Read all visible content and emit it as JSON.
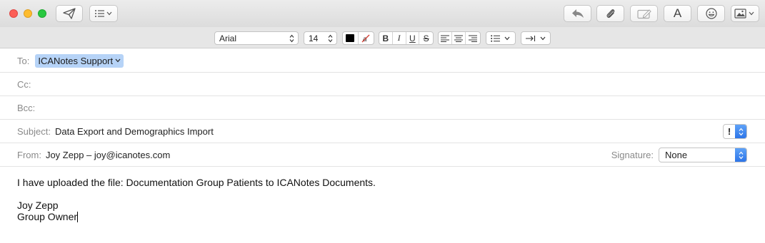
{
  "window": {
    "traffic_lights": [
      "close",
      "minimize",
      "zoom"
    ]
  },
  "toolbar": {
    "left_icons": [
      "send-icon",
      "header-fields-icon"
    ],
    "right_icons": [
      "reply-icon",
      "attachment-icon",
      "markup-icon",
      "fonts-icon",
      "emoji-icon",
      "photo-browser-icon"
    ],
    "fonts_glyph": "A"
  },
  "format_bar": {
    "font_family": "Arial",
    "font_size": "14",
    "text_color": "#000000",
    "style_buttons": [
      "B",
      "I",
      "U",
      "S"
    ],
    "alignment": [
      "align-left",
      "align-center",
      "align-right"
    ],
    "list_icon": "bulleted-list-icon",
    "indent_icon": "indent-icon"
  },
  "header": {
    "to_label": "To:",
    "to_recipient": "ICANotes Support",
    "cc_label": "Cc:",
    "bcc_label": "Bcc:",
    "subject_label": "Subject:",
    "subject_value": "Data Export and Demographics Import",
    "priority_glyph": "!",
    "from_label": "From:",
    "from_value": "Joy Zepp – joy@icanotes.com",
    "signature_label": "Signature:",
    "signature_value": "None"
  },
  "message": {
    "line1": "I have uploaded the file: Documentation Group Patients to ICANotes Documents.",
    "line2": "Joy Zepp",
    "line3": "Group Owner"
  },
  "colors": {
    "recipient_highlight": "#b6d3f7",
    "accent_blue": "#2d75e8"
  }
}
